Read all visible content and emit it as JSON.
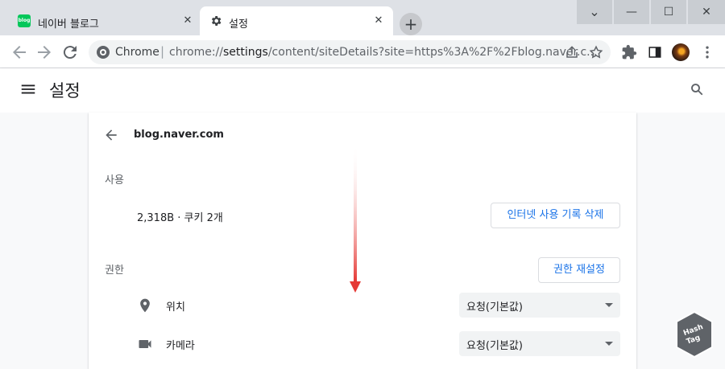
{
  "tabs": [
    {
      "favicon_text": "blog",
      "title": "네이버 블로그",
      "close": "✕"
    },
    {
      "title": "설정",
      "close": "✕"
    }
  ],
  "new_tab": "+",
  "window": {
    "minimize": "—",
    "maximize": "☐",
    "close": "✕",
    "chevron": "⌄"
  },
  "omnibox": {
    "site_name": "Chrome",
    "separator": "|",
    "url_prefix": "chrome://",
    "url_host": "settings",
    "url_rest": "/content/siteDetails?site=https%3A%2F%2Fblog.naver.c..."
  },
  "settings_header": {
    "title": "설정"
  },
  "site": {
    "name": "blog.naver.com"
  },
  "usage": {
    "section_label": "사용",
    "summary": "2,318B · 쿠키 2개",
    "clear_button": "인터넷 사용 기록 삭제"
  },
  "permissions": {
    "section_label": "권한",
    "reset_button": "권한 재설정",
    "items": [
      {
        "icon": "location-icon",
        "label": "위치",
        "value": "요청(기본값)"
      },
      {
        "icon": "camera-icon",
        "label": "카메라",
        "value": "요청(기본값)"
      }
    ]
  },
  "watermark": {
    "line1": "Hash",
    "line2": "Tag"
  },
  "colors": {
    "accent": "#1a73e8",
    "arrow": "#e53935",
    "naver_green": "#03c75a"
  }
}
